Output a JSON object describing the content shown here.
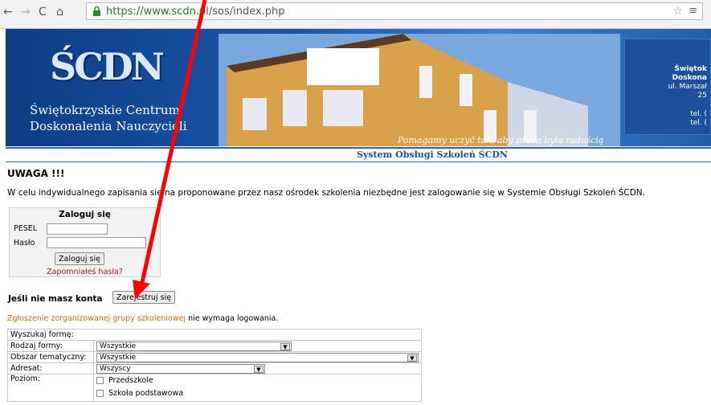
{
  "browser": {
    "back_icon": "arrow-left-icon",
    "forward_icon": "arrow-right-icon",
    "reload_icon": "reload-icon",
    "home_icon": "home-icon",
    "url_scheme_host": "https://www.scdn.pl",
    "url_path": "/sos/index.php",
    "star_icon": "star-icon"
  },
  "banner": {
    "logo_text": "ŚCDN",
    "org_name_line1": "Świętokrzyskie Centrum",
    "org_name_line2": "Doskonalenia Nauczycieli",
    "slogan": "Pomagamy uczyć tak, aby praca była radością",
    "info_lines": [
      "Świętok",
      "Doskona",
      "ul. Marszał",
      "25",
      "",
      "tel. (",
      "tel. ("
    ]
  },
  "system_title": "System Obsługi Szkoleń ŚCDN",
  "warning_heading": "UWAGA !!!",
  "intro_text": "W celu indywidualnego zapisania się na proponowane przez nasz ośrodek szkolenia niezbędne jest zalogowanie się w Systemie Obsługi Szkoleń ŚCDN.",
  "login": {
    "title": "Zaloguj się",
    "pesel_label": "PESEL",
    "password_label": "Hasło",
    "pesel_value": "",
    "password_value": "",
    "submit_label": "Zaloguj się",
    "forgot_label": "Zapomniałeś hasła?"
  },
  "register": {
    "prompt": "Jeśli nie masz konta",
    "button_label": "Zarejestruj się"
  },
  "group_notice": {
    "link_text": "Zgłoszenie zorganizowanej grupy szkoleniowej",
    "suffix": " nie wymaga logowania."
  },
  "search_form": {
    "header": "Wyszukaj formę:",
    "rows": [
      {
        "label": "Rodzaj formy:",
        "value": "Wszystkie"
      },
      {
        "label": "Obszar tematyczny:",
        "value": "Wszystkie"
      },
      {
        "label": "Adresat:",
        "value": "Wszyscy"
      },
      {
        "label": "Poziom:",
        "options": [
          "Przedszkole",
          "Szkoła podstawowa"
        ]
      }
    ]
  },
  "annotation": {
    "arrow_color": "#ff0000"
  }
}
